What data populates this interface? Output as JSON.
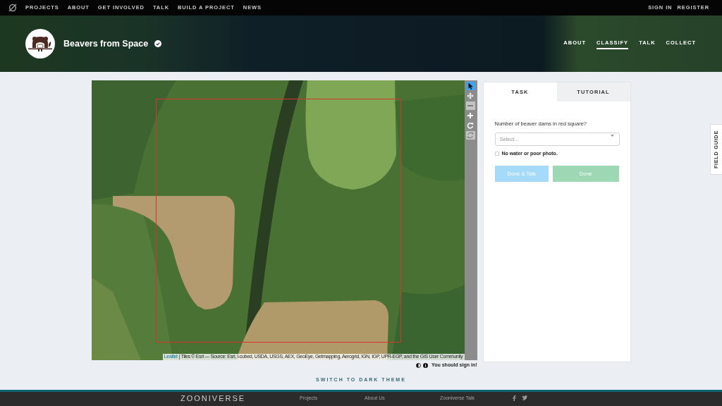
{
  "top_nav": {
    "links": [
      "PROJECTS",
      "ABOUT",
      "GET INVOLVED",
      "TALK",
      "BUILD A PROJECT",
      "NEWS"
    ],
    "account_links": [
      "SIGN IN",
      "REGISTER"
    ]
  },
  "project_header": {
    "title": "Beavers from Space",
    "verified": true,
    "tabs": [
      {
        "label": "ABOUT",
        "selected": false
      },
      {
        "label": "CLASSIFY",
        "selected": true
      },
      {
        "label": "TALK",
        "selected": false
      },
      {
        "label": "COLLECT",
        "selected": false
      }
    ]
  },
  "subject_viewer": {
    "toolbar": [
      {
        "kind": "pointer",
        "selected": true,
        "disabled": false
      },
      {
        "kind": "move",
        "selected": false,
        "disabled": false
      },
      {
        "kind": "zoom-out",
        "selected": false,
        "disabled": true
      },
      {
        "kind": "zoom-in",
        "selected": false,
        "disabled": false
      },
      {
        "kind": "rotate",
        "selected": false,
        "disabled": false
      },
      {
        "kind": "reset",
        "selected": false,
        "disabled": true
      }
    ],
    "attribution": {
      "link": "Leaflet",
      "text": "| Tiles © Esri — Source: Esri, i-cubed, USDA, USGS, AEX, GeoEye, Getmapping, Aerogrid, IGN, IGP, UPR-EGP, and the GIS User Community"
    },
    "sign_in_note": "You should sign in!"
  },
  "task_panel": {
    "tabs": [
      {
        "label": "TASK",
        "selected": true
      },
      {
        "label": "TUTORIAL",
        "selected": false
      }
    ],
    "question": "Number of beaver dams in red square?",
    "select": {
      "placeholder": "Select..."
    },
    "checkbox": {
      "label": "No water or poor photo.",
      "checked": false
    },
    "buttons": [
      {
        "label": "Done & Talk",
        "kind": "talk",
        "disabled": true
      },
      {
        "label": "Done",
        "kind": "done",
        "disabled": true
      }
    ]
  },
  "field_guide": {
    "label": "FIELD GUIDE"
  },
  "theme_switch": "SWITCH TO DARK THEME",
  "footer": {
    "logo_text": "ZOONIVERSE",
    "links": [
      "Projects",
      "About Us",
      "Zooniverse Talk"
    ]
  }
}
